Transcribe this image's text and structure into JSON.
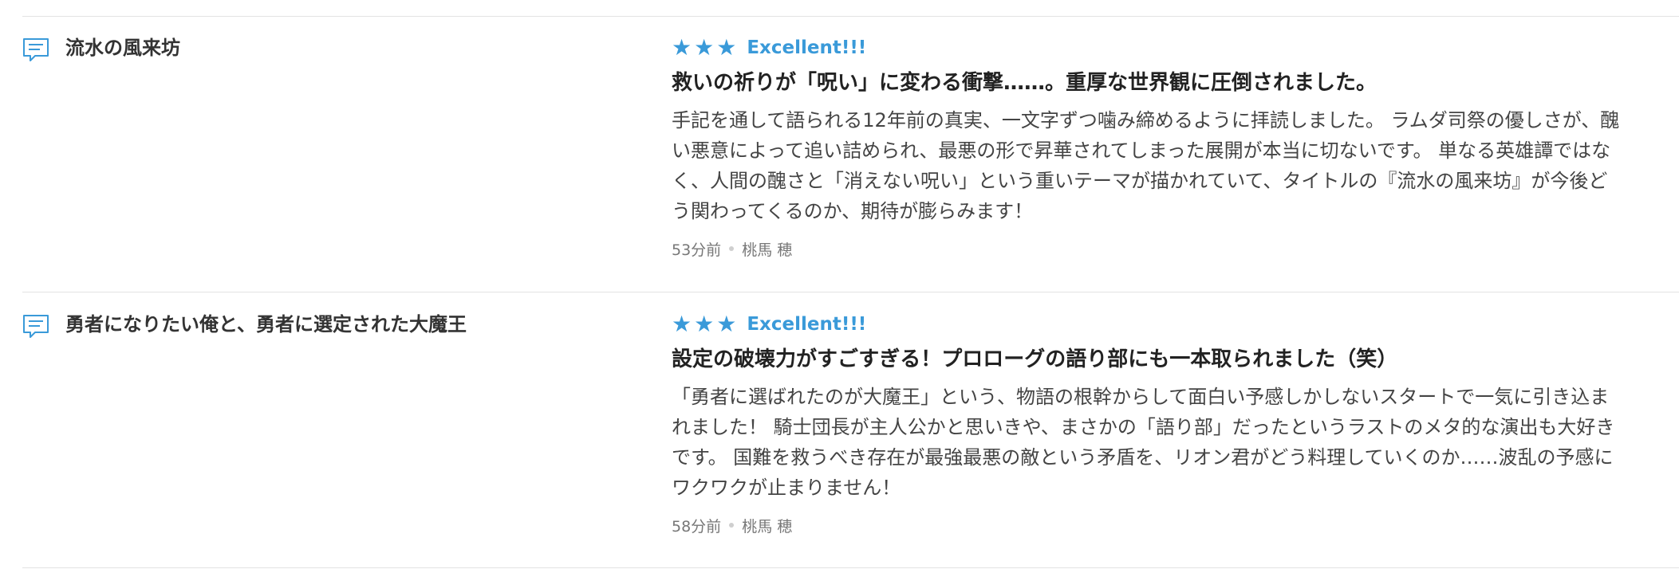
{
  "colors": {
    "accent": "#3a9ad9",
    "divider": "#e3e3e3",
    "text": "#333333",
    "muted": "#777777"
  },
  "reviews": [
    {
      "work_title": "流水の風来坊",
      "stars": "★★★",
      "rating_label": "Excellent!!!",
      "review_title": "救いの祈りが「呪い」に変わる衝撃……。重厚な世界観に圧倒されました。",
      "review_lines": [
        "手記を通して語られる12年前の真実、一文字ずつ噛み締めるように拝読しました。 ラムダ司祭の優しさが、醜",
        "い悪意によって追い詰められ、最悪の形で昇華されてしまった展開が本当に切ないです。 単なる英雄譚ではな",
        "く、人間の醜さと「消えない呪い」という重いテーマが描かれていて、タイトルの『流水の風来坊』が今後ど",
        "う関わってくるのか、期待が膨らみます！"
      ],
      "time": "53分前",
      "author": "桃馬 穂"
    },
    {
      "work_title": "勇者になりたい俺と、勇者に選定された大魔王",
      "stars": "★★★",
      "rating_label": "Excellent!!!",
      "review_title": "設定の破壊力がすごすぎる！プロローグの語り部にも一本取られました（笑）",
      "review_lines": [
        "「勇者に選ばれたのが大魔王」という、物語の根幹からして面白い予感しかしないスタートで一気に引き込ま",
        "れました！ 騎士団長が主人公かと思いきや、まさかの「語り部」だったというラストのメタ的な演出も大好き",
        "です。 国難を救うべき存在が最強最悪の敵という矛盾を、リオン君がどう料理していくのか……波乱の予感に",
        "ワクワクが止まりません！"
      ],
      "time": "58分前",
      "author": "桃馬 穂"
    }
  ]
}
